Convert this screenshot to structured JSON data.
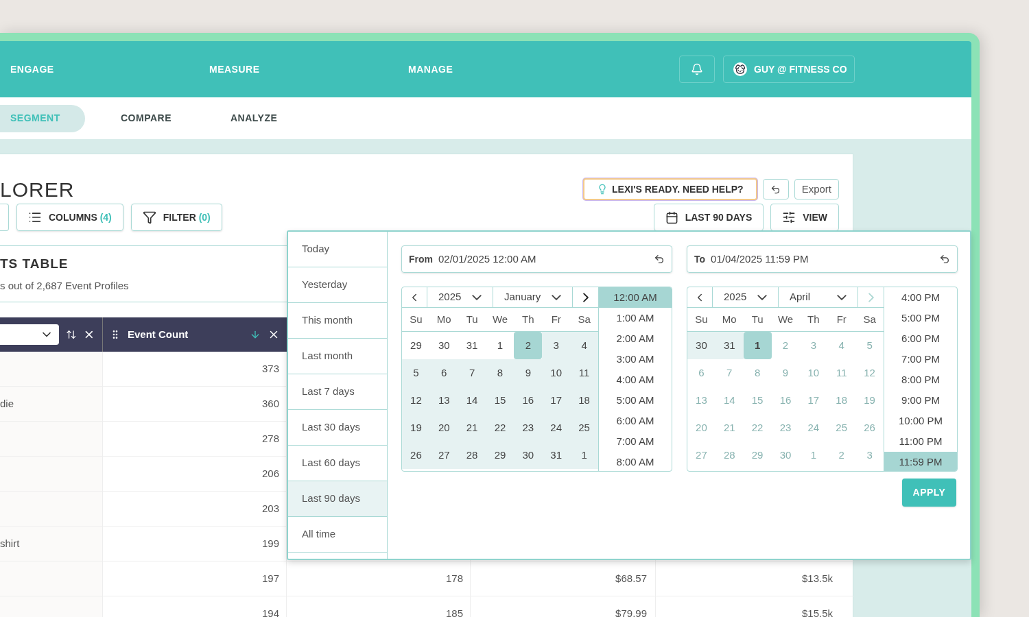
{
  "nav": {
    "items": [
      {
        "label": "ENGAGE"
      },
      {
        "label": "MEASURE"
      },
      {
        "label": "MANAGE"
      }
    ],
    "account": "GUY @ FITNESS CO"
  },
  "subnav": [
    {
      "label": "SEGMENT",
      "selected": true
    },
    {
      "label": "COMPARE",
      "selected": false
    },
    {
      "label": "ANALYZE",
      "selected": false
    }
  ],
  "page": {
    "title": "LORER",
    "help_button": "LEXI'S READY. NEED HELP?",
    "export_button": "Export",
    "toolbar": [
      {
        "kind": "columns",
        "label": "COLUMNS",
        "count": "(4)"
      },
      {
        "kind": "filter",
        "label": "FILTER",
        "count": "(0)"
      }
    ],
    "date_button": "LAST 90 DAYS",
    "view_button": "VIEW"
  },
  "table": {
    "title": "TS TABLE",
    "subtitle": "s out of 2,687 Event Profiles",
    "columns": [
      {
        "kind": "select"
      },
      {
        "kind": "label",
        "label": "Event Count"
      }
    ],
    "rows": [
      {
        "count": "373"
      },
      {
        "name": "die",
        "count": "360"
      },
      {
        "count": "278"
      },
      {
        "count": "206"
      },
      {
        "count": "203"
      },
      {
        "name": "shirt",
        "count": "199"
      },
      {
        "count": "197",
        "column_3": "178",
        "column_4": "$68.57",
        "column_5": "$13.5k"
      },
      {
        "count": "194",
        "column_3": "185",
        "column_4": "$79.99",
        "column_5": "$15.5k"
      }
    ]
  },
  "date_picker": {
    "presets": [
      {
        "label": "Today",
        "selected": false
      },
      {
        "label": "Yesterday",
        "selected": false
      },
      {
        "label": "This month",
        "selected": false
      },
      {
        "label": "Last month",
        "selected": false
      },
      {
        "label": "Last 7 days",
        "selected": false
      },
      {
        "label": "Last 30 days",
        "selected": false
      },
      {
        "label": "Last 60 days",
        "selected": false
      },
      {
        "label": "Last 90 days",
        "selected": true
      },
      {
        "label": "All time",
        "selected": false
      }
    ],
    "calendars": [
      {
        "field_label": "From",
        "field_value": "02/01/2025 12:00 AM",
        "year": "2025",
        "month": "January",
        "next_disabled": false,
        "weekdays": [
          "Su",
          "Mo",
          "Tu",
          "We",
          "Th",
          "Fr",
          "Sa"
        ],
        "weeks": [
          [
            {
              "label": "29",
              "in_range": false,
              "selected": false,
              "disabled": false
            },
            {
              "label": "30",
              "in_range": false,
              "selected": false,
              "disabled": false
            },
            {
              "label": "31",
              "in_range": false,
              "selected": false,
              "disabled": false
            },
            {
              "label": "1",
              "in_range": false,
              "selected": false,
              "disabled": false
            },
            {
              "label": "2",
              "in_range": true,
              "selected": true,
              "disabled": false
            },
            {
              "label": "3",
              "in_range": true,
              "selected": false,
              "disabled": false
            },
            {
              "label": "4",
              "in_range": true,
              "selected": false,
              "disabled": false
            }
          ],
          [
            {
              "label": "5",
              "in_range": true,
              "selected": false,
              "disabled": false
            },
            {
              "label": "6",
              "in_range": true,
              "selected": false,
              "disabled": false
            },
            {
              "label": "7",
              "in_range": true,
              "selected": false,
              "disabled": false
            },
            {
              "label": "8",
              "in_range": true,
              "selected": false,
              "disabled": false
            },
            {
              "label": "9",
              "in_range": true,
              "selected": false,
              "disabled": false
            },
            {
              "label": "10",
              "in_range": true,
              "selected": false,
              "disabled": false
            },
            {
              "label": "11",
              "in_range": true,
              "selected": false,
              "disabled": false
            }
          ],
          [
            {
              "label": "12",
              "in_range": true,
              "selected": false,
              "disabled": false
            },
            {
              "label": "13",
              "in_range": true,
              "selected": false,
              "disabled": false
            },
            {
              "label": "14",
              "in_range": true,
              "selected": false,
              "disabled": false
            },
            {
              "label": "15",
              "in_range": true,
              "selected": false,
              "disabled": false
            },
            {
              "label": "16",
              "in_range": true,
              "selected": false,
              "disabled": false
            },
            {
              "label": "17",
              "in_range": true,
              "selected": false,
              "disabled": false
            },
            {
              "label": "18",
              "in_range": true,
              "selected": false,
              "disabled": false
            }
          ],
          [
            {
              "label": "19",
              "in_range": true,
              "selected": false,
              "disabled": false
            },
            {
              "label": "20",
              "in_range": true,
              "selected": false,
              "disabled": false
            },
            {
              "label": "21",
              "in_range": true,
              "selected": false,
              "disabled": false
            },
            {
              "label": "22",
              "in_range": true,
              "selected": false,
              "disabled": false
            },
            {
              "label": "23",
              "in_range": true,
              "selected": false,
              "disabled": false
            },
            {
              "label": "24",
              "in_range": true,
              "selected": false,
              "disabled": false
            },
            {
              "label": "25",
              "in_range": true,
              "selected": false,
              "disabled": false
            }
          ],
          [
            {
              "label": "26",
              "in_range": true,
              "selected": false,
              "disabled": false
            },
            {
              "label": "27",
              "in_range": true,
              "selected": false,
              "disabled": false
            },
            {
              "label": "28",
              "in_range": true,
              "selected": false,
              "disabled": false
            },
            {
              "label": "29",
              "in_range": true,
              "selected": false,
              "disabled": false
            },
            {
              "label": "30",
              "in_range": true,
              "selected": false,
              "disabled": false
            },
            {
              "label": "31",
              "in_range": true,
              "selected": false,
              "disabled": false
            },
            {
              "label": "1",
              "in_range": true,
              "selected": false,
              "disabled": false
            }
          ]
        ],
        "times": [
          {
            "label": "12:00 AM",
            "selected": true
          },
          {
            "label": "1:00 AM",
            "selected": false
          },
          {
            "label": "2:00 AM",
            "selected": false
          },
          {
            "label": "3:00 AM",
            "selected": false
          },
          {
            "label": "4:00 AM",
            "selected": false
          },
          {
            "label": "5:00 AM",
            "selected": false
          },
          {
            "label": "6:00 AM",
            "selected": false
          },
          {
            "label": "7:00 AM",
            "selected": false
          },
          {
            "label": "8:00 AM",
            "selected": false
          }
        ]
      },
      {
        "field_label": "To",
        "field_value": "01/04/2025 11:59 PM",
        "year": "2025",
        "month": "April",
        "next_disabled": true,
        "weekdays": [
          "Su",
          "Mo",
          "Tu",
          "We",
          "Th",
          "Fr",
          "Sa"
        ],
        "weeks": [
          [
            {
              "label": "30",
              "in_range": true,
              "selected": false,
              "disabled": false
            },
            {
              "label": "31",
              "in_range": true,
              "selected": false,
              "disabled": false
            },
            {
              "label": "1",
              "in_range": true,
              "selected": true,
              "disabled": false
            },
            {
              "label": "2",
              "in_range": false,
              "selected": false,
              "disabled": true
            },
            {
              "label": "3",
              "in_range": false,
              "selected": false,
              "disabled": true
            },
            {
              "label": "4",
              "in_range": false,
              "selected": false,
              "disabled": true
            },
            {
              "label": "5",
              "in_range": false,
              "selected": false,
              "disabled": true
            }
          ],
          [
            {
              "label": "6",
              "in_range": false,
              "selected": false,
              "disabled": true
            },
            {
              "label": "7",
              "in_range": false,
              "selected": false,
              "disabled": true
            },
            {
              "label": "8",
              "in_range": false,
              "selected": false,
              "disabled": true
            },
            {
              "label": "9",
              "in_range": false,
              "selected": false,
              "disabled": true
            },
            {
              "label": "10",
              "in_range": false,
              "selected": false,
              "disabled": true
            },
            {
              "label": "11",
              "in_range": false,
              "selected": false,
              "disabled": true
            },
            {
              "label": "12",
              "in_range": false,
              "selected": false,
              "disabled": true
            }
          ],
          [
            {
              "label": "13",
              "in_range": false,
              "selected": false,
              "disabled": true
            },
            {
              "label": "14",
              "in_range": false,
              "selected": false,
              "disabled": true
            },
            {
              "label": "15",
              "in_range": false,
              "selected": false,
              "disabled": true
            },
            {
              "label": "16",
              "in_range": false,
              "selected": false,
              "disabled": true
            },
            {
              "label": "17",
              "in_range": false,
              "selected": false,
              "disabled": true
            },
            {
              "label": "18",
              "in_range": false,
              "selected": false,
              "disabled": true
            },
            {
              "label": "19",
              "in_range": false,
              "selected": false,
              "disabled": true
            }
          ],
          [
            {
              "label": "20",
              "in_range": false,
              "selected": false,
              "disabled": true
            },
            {
              "label": "21",
              "in_range": false,
              "selected": false,
              "disabled": true
            },
            {
              "label": "22",
              "in_range": false,
              "selected": false,
              "disabled": true
            },
            {
              "label": "23",
              "in_range": false,
              "selected": false,
              "disabled": true
            },
            {
              "label": "24",
              "in_range": false,
              "selected": false,
              "disabled": true
            },
            {
              "label": "25",
              "in_range": false,
              "selected": false,
              "disabled": true
            },
            {
              "label": "26",
              "in_range": false,
              "selected": false,
              "disabled": true
            }
          ],
          [
            {
              "label": "27",
              "in_range": false,
              "selected": false,
              "disabled": true
            },
            {
              "label": "28",
              "in_range": false,
              "selected": false,
              "disabled": true
            },
            {
              "label": "29",
              "in_range": false,
              "selected": false,
              "disabled": true
            },
            {
              "label": "30",
              "in_range": false,
              "selected": false,
              "disabled": true
            },
            {
              "label": "1",
              "in_range": false,
              "selected": false,
              "disabled": true
            },
            {
              "label": "2",
              "in_range": false,
              "selected": false,
              "disabled": true
            },
            {
              "label": "3",
              "in_range": false,
              "selected": false,
              "disabled": true
            }
          ]
        ],
        "times": [
          {
            "label": "4:00 PM",
            "selected": false
          },
          {
            "label": "5:00 PM",
            "selected": false
          },
          {
            "label": "6:00 PM",
            "selected": false
          },
          {
            "label": "7:00 PM",
            "selected": false
          },
          {
            "label": "8:00 PM",
            "selected": false
          },
          {
            "label": "9:00 PM",
            "selected": false
          },
          {
            "label": "10:00 PM",
            "selected": false
          },
          {
            "label": "11:00 PM",
            "selected": false
          },
          {
            "label": "11:59 PM",
            "selected": true
          }
        ]
      }
    ],
    "apply_button": "APPLY"
  }
}
